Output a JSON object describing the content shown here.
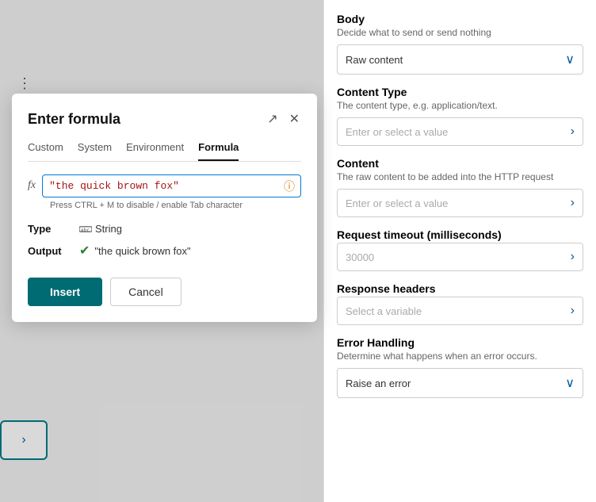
{
  "modal": {
    "title": "Enter formula",
    "expand_icon": "expand-icon",
    "close_icon": "close-icon",
    "tabs": [
      {
        "id": "custom",
        "label": "Custom",
        "active": false
      },
      {
        "id": "system",
        "label": "System",
        "active": false
      },
      {
        "id": "environment",
        "label": "Environment",
        "active": false
      },
      {
        "id": "formula",
        "label": "Formula",
        "active": true
      }
    ],
    "fx_label": "fx",
    "formula_value": "\"the quick brown fox\"",
    "formula_hint": "Press CTRL + M to disable / enable Tab character",
    "info_icon": "info-icon",
    "type_label": "Type",
    "type_value": "String",
    "output_label": "Output",
    "output_value": "\"the quick brown fox\"",
    "insert_button": "Insert",
    "cancel_button": "Cancel"
  },
  "right_panel": {
    "body": {
      "title": "Body",
      "desc": "Decide what to send or send nothing",
      "dropdown_value": "Raw content"
    },
    "content_type": {
      "title": "Content Type",
      "desc": "The content type, e.g. application/text.",
      "placeholder": "Enter or select a value"
    },
    "content": {
      "title": "Content",
      "desc": "The raw content to be added into the HTTP request",
      "placeholder": "Enter or select a value"
    },
    "request_timeout": {
      "title": "Request timeout (milliseconds)",
      "value": "30000"
    },
    "response_headers": {
      "title": "Response headers",
      "placeholder": "Select a variable"
    },
    "error_handling": {
      "title": "Error Handling",
      "desc": "Determine what happens when an error occurs.",
      "dropdown_value": "Raise an error"
    }
  },
  "icons": {
    "chevron_down": "∨",
    "chevron_right": "›",
    "expand": "↗",
    "close": "✕",
    "info": "ⓘ",
    "check": "✔",
    "string_type": "abc"
  }
}
